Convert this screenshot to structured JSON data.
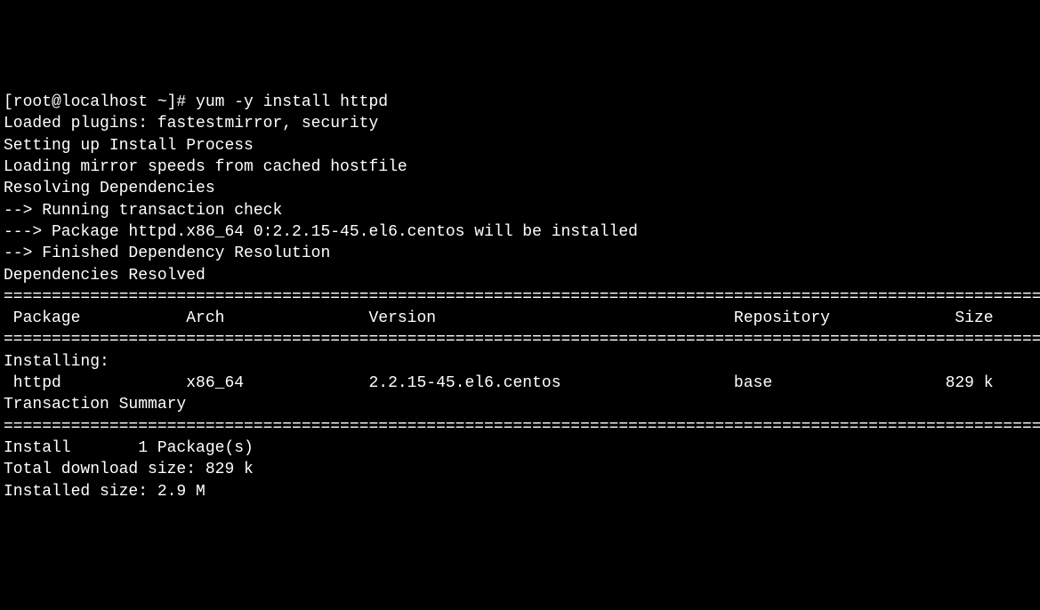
{
  "terminal": {
    "prompt": "[root@localhost ~]# ",
    "command": "yum -y install httpd",
    "output": {
      "line1": "Loaded plugins: fastestmirror, security",
      "line2": "Setting up Install Process",
      "line3": "Loading mirror speeds from cached hostfile",
      "line4": "Resolving Dependencies",
      "line5": "--> Running transaction check",
      "line6": "---> Package httpd.x86_64 0:2.2.15-45.el6.centos will be installed",
      "line7": "--> Finished Dependency Resolution",
      "line8": "",
      "line9": "Dependencies Resolved",
      "line10": "",
      "divider1": "================================================================================================================",
      "header": " Package           Arch               Version                               Repository             Size",
      "divider2": "================================================================================================================",
      "installing_label": "Installing:",
      "package_row": " httpd             x86_64             2.2.15-45.el6.centos                  base                  829 k",
      "line_blank2": "",
      "summary_label": "Transaction Summary",
      "divider3": "================================================================================================================",
      "install_count": "Install       1 Package(s)",
      "line_blank3": "",
      "download_size": "Total download size: 829 k",
      "installed_size": "Installed size: 2.9 M"
    }
  },
  "package_data": {
    "name": "httpd",
    "arch": "x86_64",
    "version": "2.2.15-45.el6.centos",
    "repository": "base",
    "size": "829 k"
  }
}
